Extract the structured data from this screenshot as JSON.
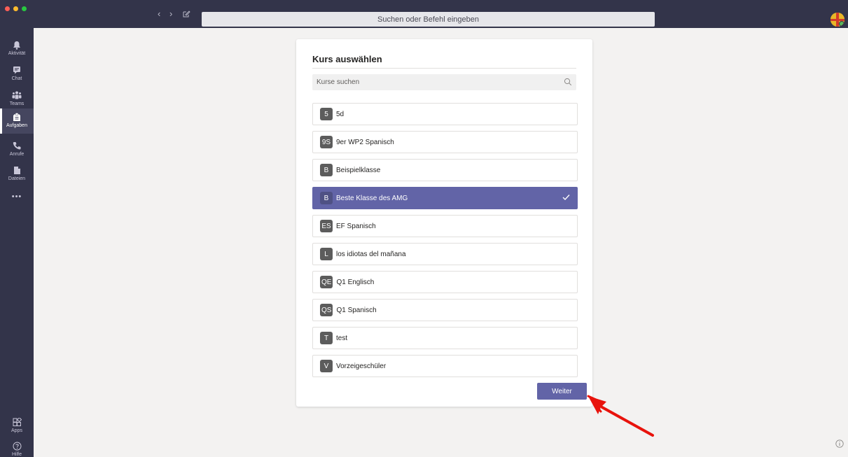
{
  "window": {
    "traffic_lights": [
      "#fe5f57",
      "#febc2e",
      "#28c840"
    ]
  },
  "header": {
    "search_placeholder": "Suchen oder Befehl eingeben"
  },
  "rail": {
    "items": [
      {
        "label": "Aktivität",
        "icon": "bell-icon"
      },
      {
        "label": "Chat",
        "icon": "chat-icon"
      },
      {
        "label": "Teams",
        "icon": "teams-icon"
      },
      {
        "label": "Aufgaben",
        "icon": "assignments-icon",
        "active": true
      },
      {
        "label": "Anrufe",
        "icon": "phone-icon"
      },
      {
        "label": "Dateien",
        "icon": "files-icon"
      }
    ],
    "more": "•••",
    "apps_label": "Apps",
    "help_label": "Hilfe"
  },
  "panel": {
    "title": "Kurs auswählen",
    "search_placeholder": "Kurse suchen",
    "courses": [
      {
        "badge": "5",
        "name": "5d"
      },
      {
        "badge": "9S",
        "name": "9er WP2 Spanisch"
      },
      {
        "badge": "B",
        "name": "Beispielklasse"
      },
      {
        "badge": "B",
        "name": "Beste Klasse des AMG",
        "selected": true
      },
      {
        "badge": "ES",
        "name": "EF Spanisch"
      },
      {
        "badge": "L",
        "name": "los idiotas del mañana"
      },
      {
        "badge": "QE",
        "name": "Q1 Englisch"
      },
      {
        "badge": "QS",
        "name": "Q1 Spanisch"
      },
      {
        "badge": "T",
        "name": "test"
      },
      {
        "badge": "V",
        "name": "Vorzeigeschüler"
      }
    ],
    "next_button": "Weiter"
  },
  "colors": {
    "accent": "#6264a7",
    "rail": "#33344a",
    "annotation": "#e8130c"
  }
}
